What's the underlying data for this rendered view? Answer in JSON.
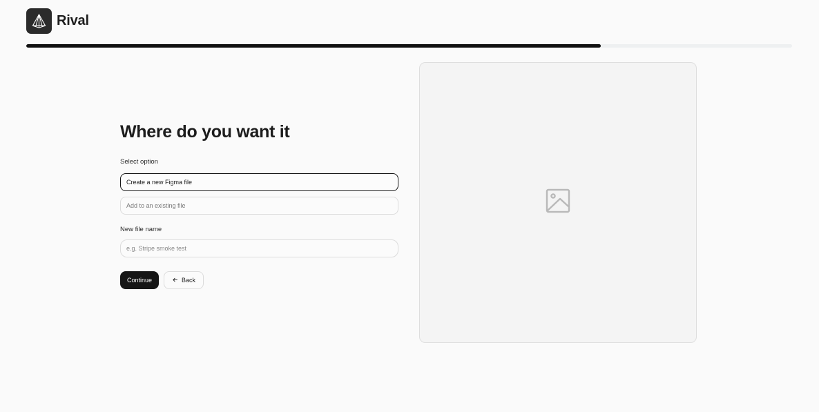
{
  "app": {
    "brand_name": "Rival",
    "logo_icon": "pyramid-logo-icon"
  },
  "progress": {
    "fraction": 0.75
  },
  "form": {
    "title": "Where do you want it",
    "select_label": "Select option",
    "options": [
      {
        "label": "Create a new Figma file",
        "selected": true
      },
      {
        "label": "Add to an existing file",
        "selected": false
      }
    ],
    "file_name_label": "New file name",
    "file_name_placeholder": "e.g. Stripe smoke test",
    "file_name_value": ""
  },
  "actions": {
    "continue_label": "Continue",
    "back_label": "Back",
    "back_icon": "arrow-left-icon"
  },
  "preview": {
    "icon": "image-placeholder-icon"
  },
  "colors": {
    "accent": "#161616",
    "background": "#fafafa",
    "progress_track": "#eef0f1"
  }
}
